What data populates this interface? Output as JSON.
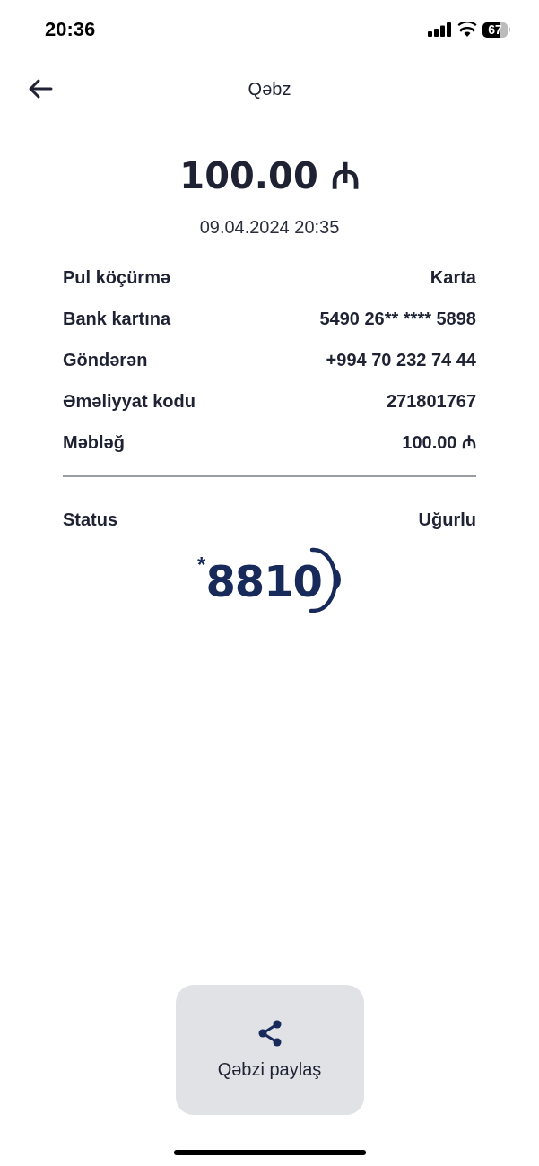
{
  "status_bar": {
    "time": "20:36",
    "battery": "67"
  },
  "header": {
    "title": "Qəbz"
  },
  "amount": "100.00 ₼",
  "date": "09.04.2024 20:35",
  "details": [
    {
      "label": "Pul köçürmə",
      "value": "Karta"
    },
    {
      "label": "Bank kartına",
      "value": "5490 26** **** 5898"
    },
    {
      "label": "Göndərən",
      "value": "+994 70 232 74 44"
    },
    {
      "label": "Əməliyyat kodu",
      "value": "271801767"
    },
    {
      "label": "Məbləğ",
      "value": "100.00 ₼"
    }
  ],
  "status": {
    "label": "Status",
    "value": "Uğurlu"
  },
  "logo": {
    "star": "*",
    "number": "8810"
  },
  "share_button": {
    "label": "Qəbzi paylaş"
  }
}
